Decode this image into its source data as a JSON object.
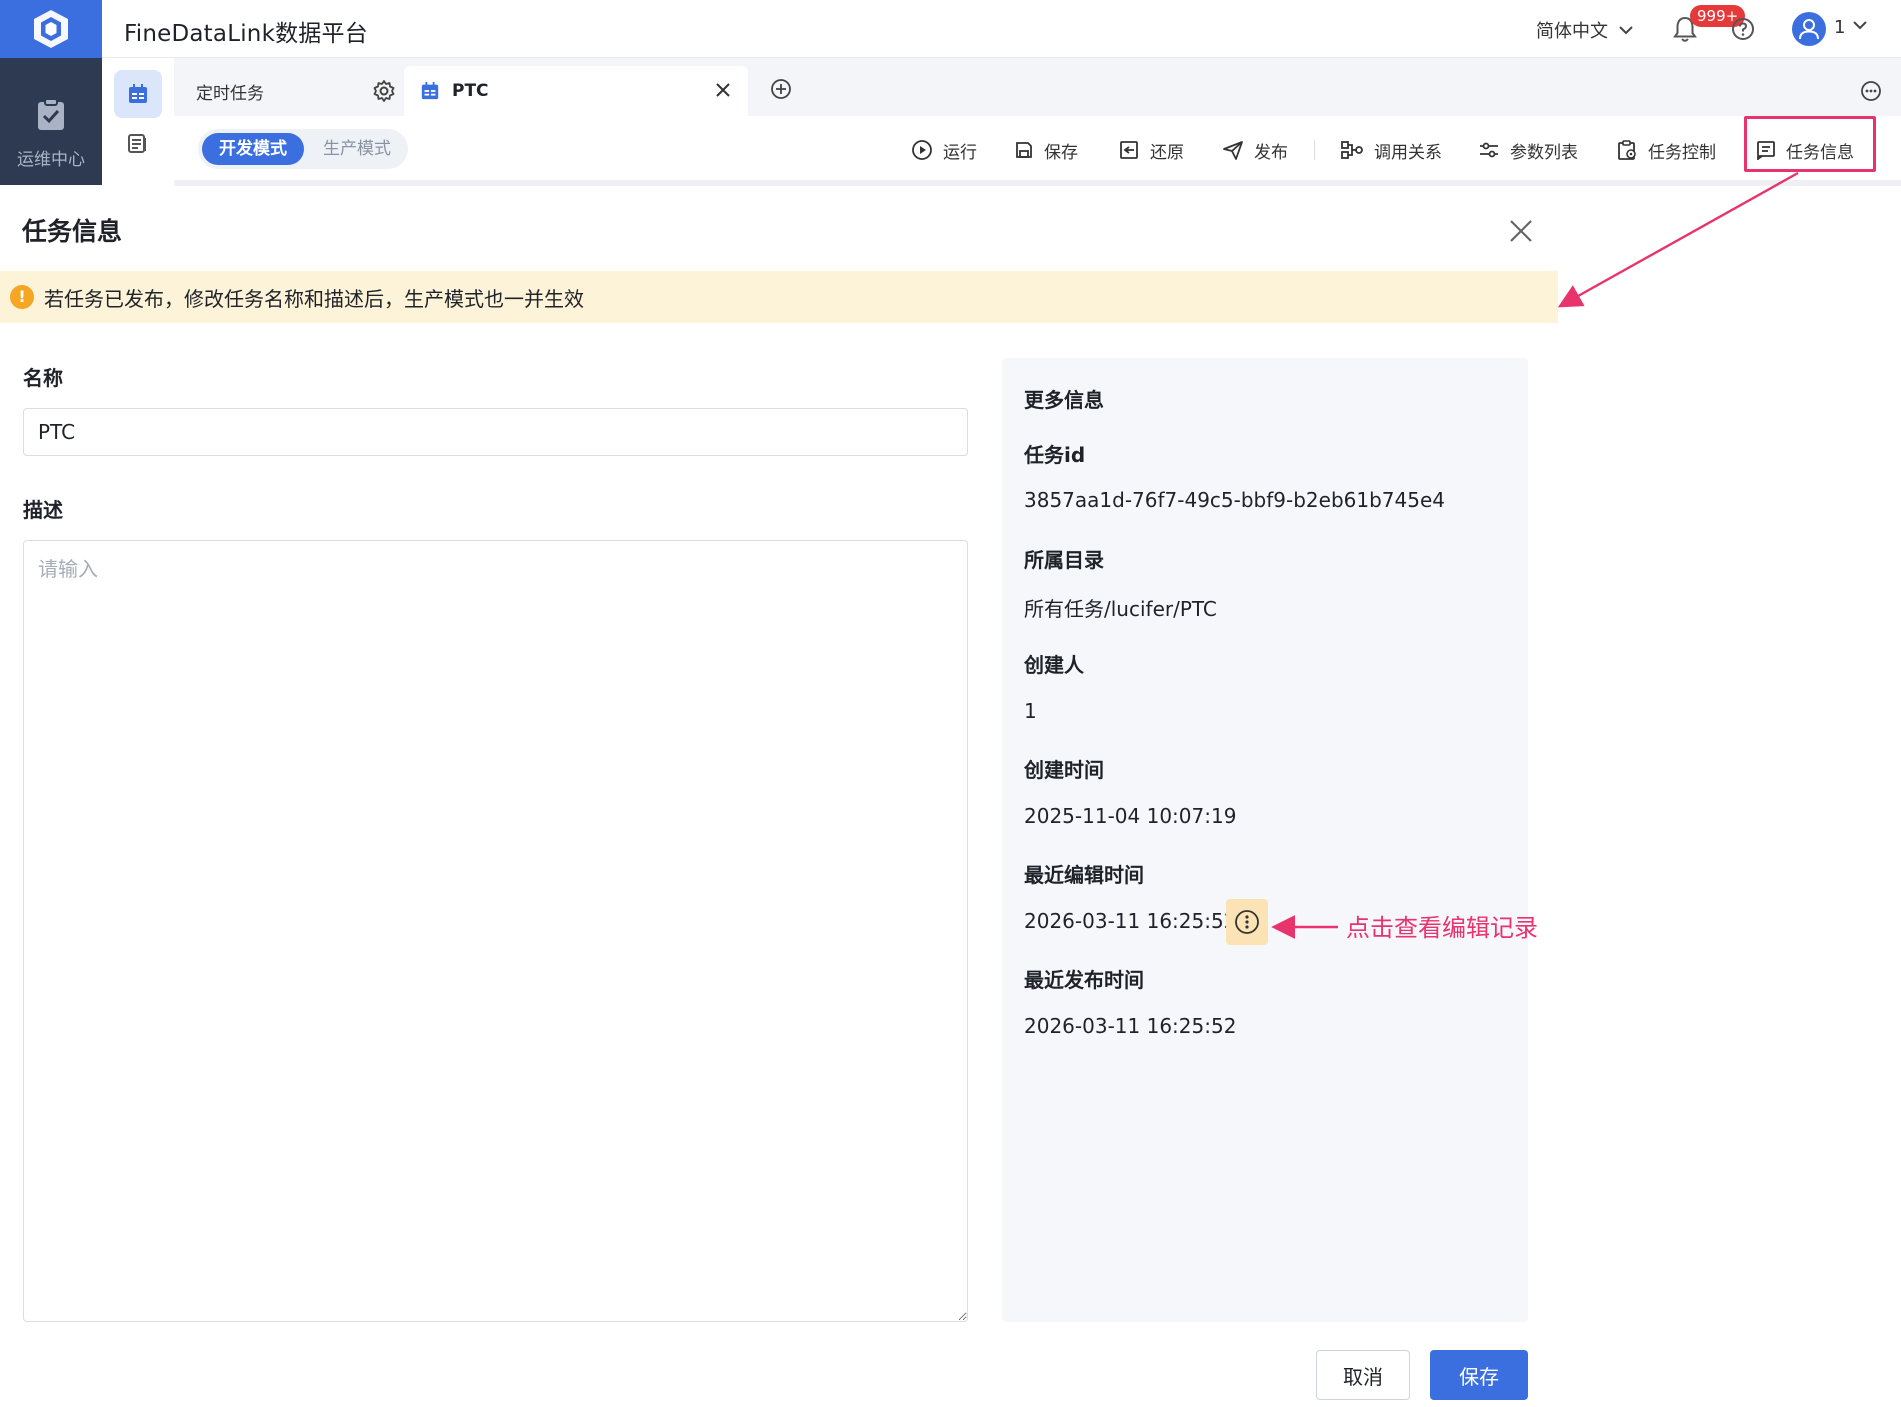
{
  "app": {
    "title": "FineDataLink数据平台",
    "brand_color": "#3b6fe0",
    "accent_pink": "#e8336d"
  },
  "header": {
    "language": "简体中文",
    "notification_badge": "999+",
    "user_name": "1",
    "icons": [
      "cube-logo-icon",
      "chevron-down-icon",
      "bell-icon",
      "help-icon",
      "user-avatar-icon"
    ]
  },
  "rail": {
    "label": "运维中心"
  },
  "tabs": [
    {
      "label": "定时任务",
      "active": false
    },
    {
      "label": "PTC",
      "active": true
    }
  ],
  "toolbar": {
    "mode_dev": "开发模式",
    "mode_prod": "生产模式",
    "run": "运行",
    "save": "保存",
    "restore": "还原",
    "publish": "发布",
    "call_relation": "调用关系",
    "param_list": "参数列表",
    "task_control": "任务控制",
    "task_info": "任务信息"
  },
  "modal": {
    "title": "任务信息",
    "notice": "若任务已发布，修改任务名称和描述后，生产模式也一并生效",
    "name_label": "名称",
    "name_value": "PTC",
    "desc_label": "描述",
    "desc_placeholder": "请输入",
    "cancel": "取消",
    "save": "保存"
  },
  "info": {
    "heading": "更多信息",
    "task_id_label": "任务id",
    "task_id": "3857aa1d-76f7-49c5-bbf9-b2eb61b745e4",
    "dir_label": "所属目录",
    "dir": "所有任务/lucifer/PTC",
    "creator_label": "创建人",
    "creator": "1",
    "created_label": "创建时间",
    "created": "2025-11-04 10:07:19",
    "edited_label": "最近编辑时间",
    "edited": "2026-03-11 16:25:52",
    "published_label": "最近发布时间",
    "published": "2026-03-11 16:25:52"
  },
  "annotation": {
    "text": "点击查看编辑记录"
  }
}
